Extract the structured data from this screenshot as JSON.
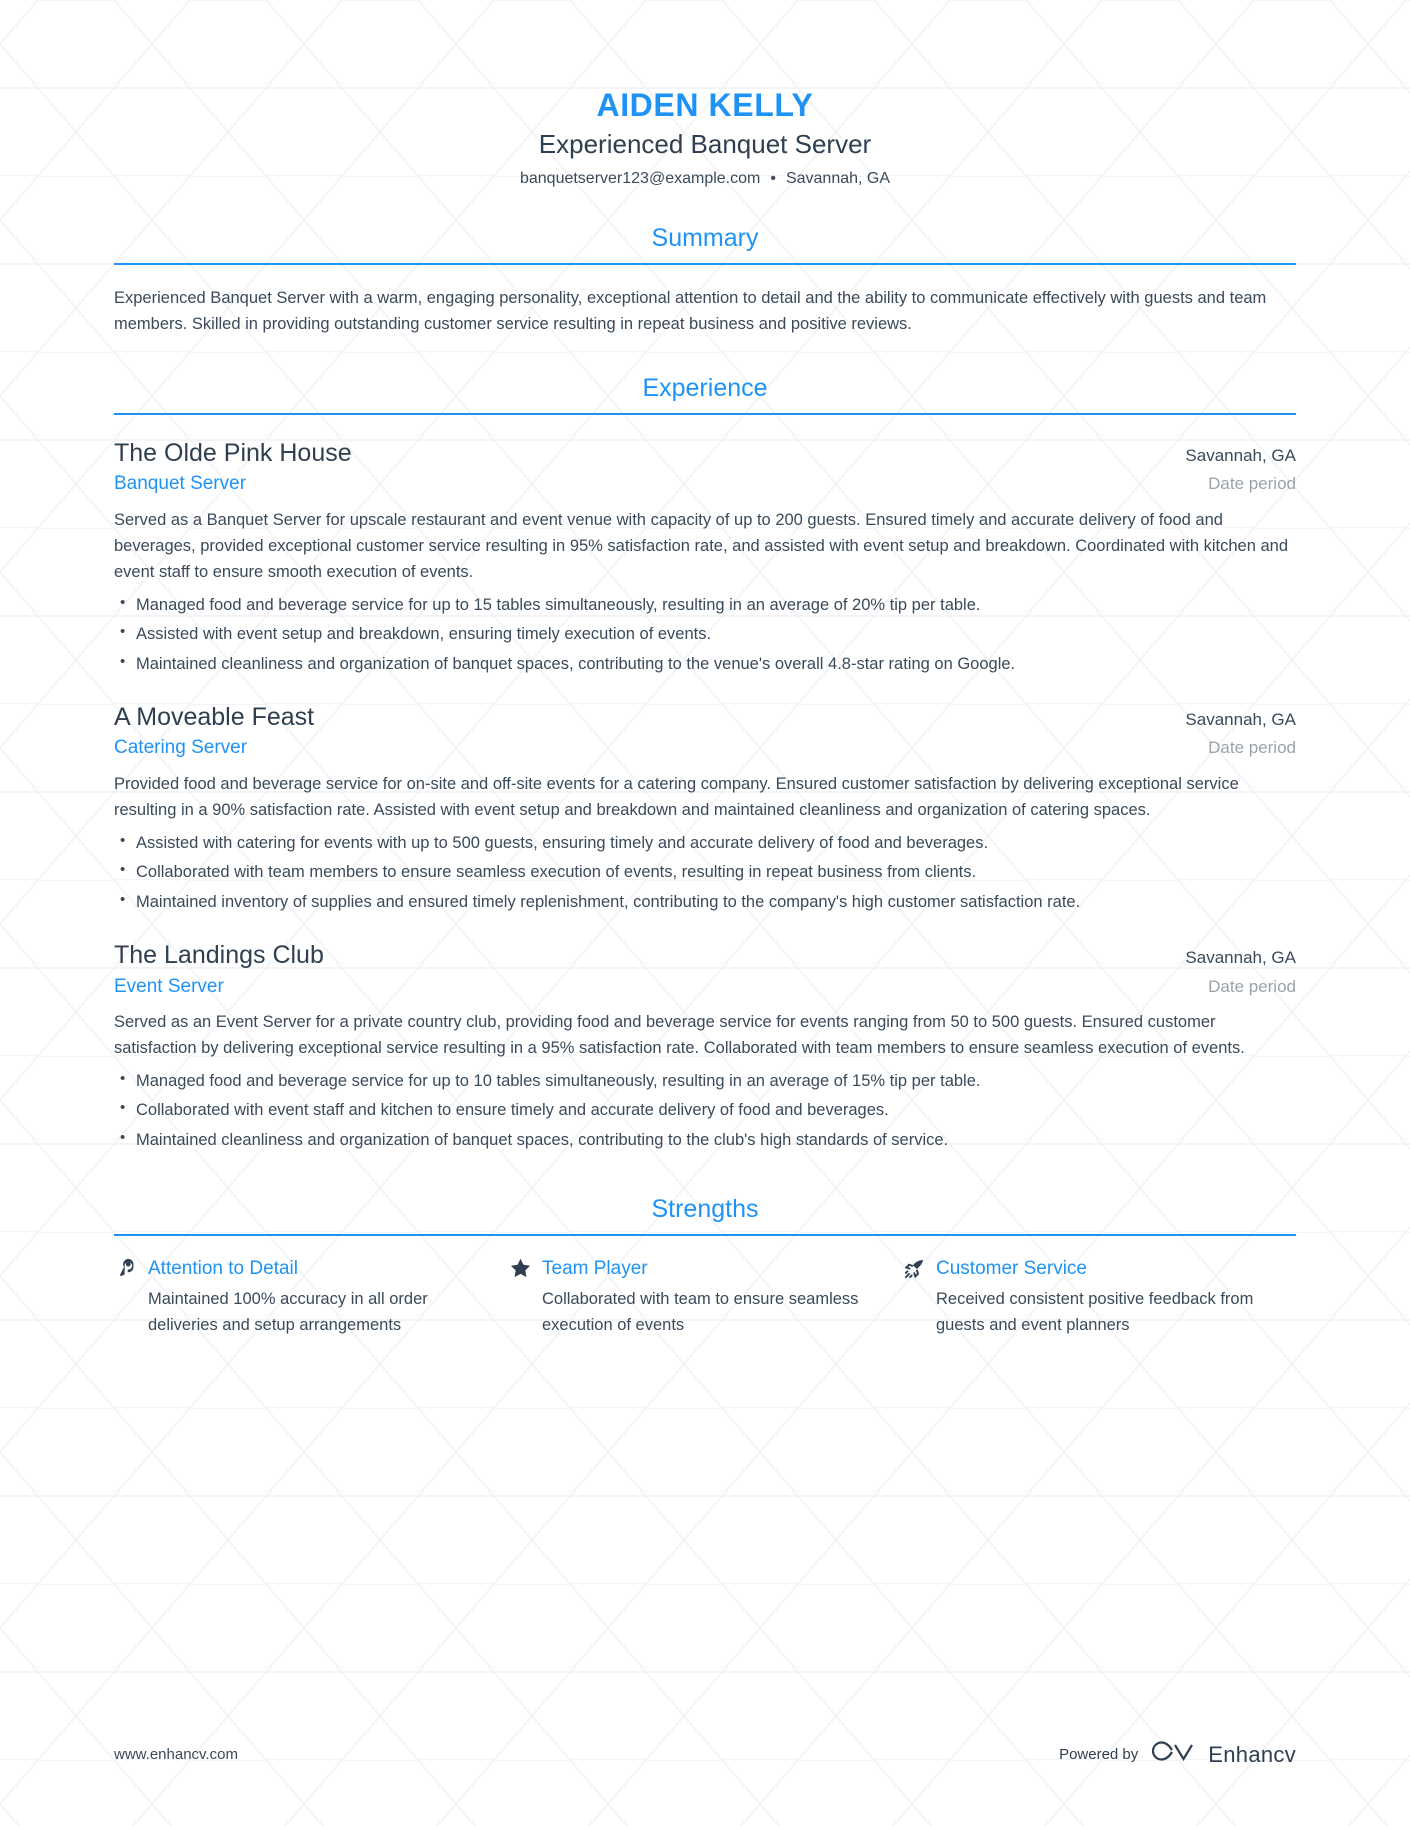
{
  "header": {
    "full_name": "AIDEN KELLY",
    "job_title": "Experienced Banquet Server",
    "email": "banquetserver123@example.com",
    "separator": "•",
    "location": "Savannah, GA"
  },
  "summary": {
    "title": "Summary",
    "text": "Experienced Banquet Server with a warm, engaging personality, exceptional attention to detail and the ability to communicate effectively with guests and team members. Skilled in providing outstanding customer service resulting in repeat business and positive reviews."
  },
  "experience": {
    "title": "Experience",
    "entries": [
      {
        "company": "The Olde Pink House",
        "location": "Savannah, GA",
        "role": "Banquet Server",
        "date": "Date period",
        "description": "Served as a Banquet Server for upscale restaurant and event venue with capacity of up to 200 guests. Ensured timely and accurate delivery of food and beverages, provided exceptional customer service resulting in 95% satisfaction rate, and assisted with event setup and breakdown. Coordinated with kitchen and event staff to ensure smooth execution of events.",
        "bullets": [
          "Managed food and beverage service for up to 15 tables simultaneously, resulting in an average of 20% tip per table.",
          "Assisted with event setup and breakdown, ensuring timely execution of events.",
          "Maintained cleanliness and organization of banquet spaces, contributing to the venue's overall 4.8-star rating on Google."
        ]
      },
      {
        "company": "A Moveable Feast",
        "location": "Savannah, GA",
        "role": "Catering Server",
        "date": "Date period",
        "description": "Provided food and beverage service for on-site and off-site events for a catering company. Ensured customer satisfaction by delivering exceptional service resulting in a 90% satisfaction rate. Assisted with event setup and breakdown and maintained cleanliness and organization of catering spaces.",
        "bullets": [
          "Assisted with catering for events with up to 500 guests, ensuring timely and accurate delivery of food and beverages.",
          "Collaborated with team members to ensure seamless execution of events, resulting in repeat business from clients.",
          "Maintained inventory of supplies and ensured timely replenishment, contributing to the company's high customer satisfaction rate."
        ]
      },
      {
        "company": "The Landings Club",
        "location": "Savannah, GA",
        "role": "Event Server",
        "date": "Date period",
        "description": "Served as an Event Server for a private country club, providing food and beverage service for events ranging from 50 to 500 guests. Ensured customer satisfaction by delivering exceptional service resulting in a 95% satisfaction rate. Collaborated with team members to ensure seamless execution of events.",
        "bullets": [
          "Managed food and beverage service for up to 10 tables simultaneously, resulting in an average of 15% tip per table.",
          "Collaborated with event staff and kitchen to ensure timely and accurate delivery of food and beverages.",
          "Maintained cleanliness and organization of banquet spaces, contributing to the club's high standards of service."
        ]
      }
    ]
  },
  "strengths": {
    "title": "Strengths",
    "items": [
      {
        "icon": "magnifier-head-icon",
        "name": "Attention to Detail",
        "description": "Maintained 100% accuracy in all order deliveries and setup arrangements"
      },
      {
        "icon": "star-icon",
        "name": "Team Player",
        "description": "Collaborated with team to ensure seamless execution of events"
      },
      {
        "icon": "rocket-icon",
        "name": "Customer Service",
        "description": "Received consistent positive feedback from guests and event planners"
      }
    ]
  },
  "footer": {
    "url": "www.enhancv.com",
    "powered_by": "Powered by",
    "brand": "Enhancv",
    "brand_logo": "enhancv-infinity-logo"
  },
  "colors": {
    "accent": "#1f93f5",
    "heading": "#2f3f50",
    "body": "#3a4a5a",
    "muted": "#9aa3ab",
    "watermark": "#eceef0"
  }
}
